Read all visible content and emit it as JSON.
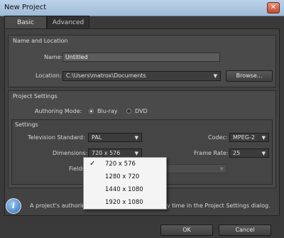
{
  "window": {
    "title": "New Project",
    "close_label": "✕"
  },
  "tabs": [
    {
      "label": "Basic",
      "active": true
    },
    {
      "label": "Advanced",
      "active": false
    }
  ],
  "name_location": {
    "title": "Name and Location",
    "name_label": "Name:",
    "name_value": "Untitled",
    "location_label": "Location:",
    "location_value": "C:\\Users\\matrox\\Documents",
    "browse_label": "Browse..."
  },
  "project_settings": {
    "title": "Project Settings",
    "authoring_label": "Authoring Mode:",
    "authoring_options": [
      {
        "label": "Blu-ray",
        "selected": true
      },
      {
        "label": "DVD",
        "selected": false
      }
    ],
    "settings_title": "Settings",
    "tv_standard_label": "Television Standard:",
    "tv_standard_value": "PAL",
    "codec_label": "Codec:",
    "codec_value": "MPEG-2",
    "dimensions_label": "Dimensions:",
    "dimensions_value": "720 x 576",
    "frame_rate_label": "Frame Rate:",
    "frame_rate_value": "25",
    "fields_label": "Fields:"
  },
  "dimensions_menu": {
    "items": [
      {
        "label": "720 x 576",
        "checked": true
      },
      {
        "label": "1280 x 720",
        "checked": false
      },
      {
        "label": "1440 x 1080",
        "checked": false
      },
      {
        "label": "1920 x 1080",
        "checked": false
      }
    ],
    "check_glyph": "✓"
  },
  "info": {
    "icon": "info-icon",
    "text_left": "A project's authorin",
    "text_right": "y time in the Project Settings dialog."
  },
  "buttons": {
    "ok": "OK",
    "cancel": "Cancel"
  }
}
